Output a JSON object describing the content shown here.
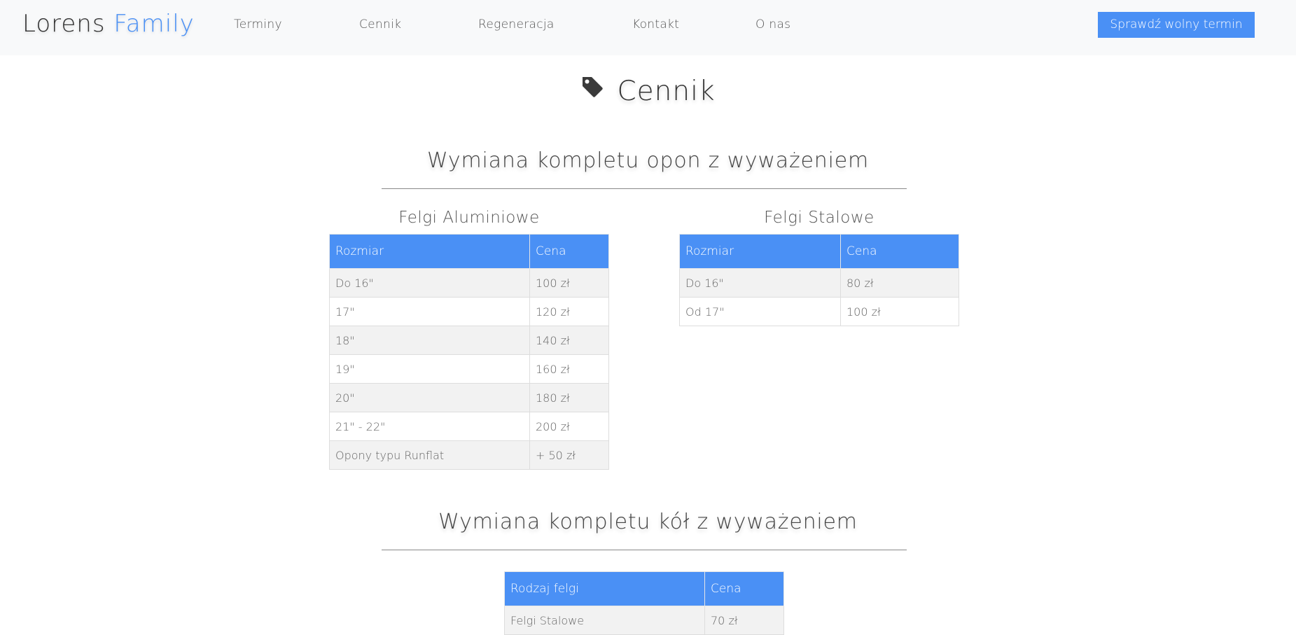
{
  "nav": {
    "brand_part1": "Lorens ",
    "brand_part2": "Family",
    "links": [
      "Terminy",
      "Cennik",
      "Regeneracja",
      "Kontakt",
      "O nas"
    ],
    "cta": "Sprawdź wolny termin"
  },
  "page": {
    "title": "Cennik",
    "icon": "tag-icon"
  },
  "section1": {
    "title": "Wymiana kompletu opon z wyważeniem",
    "aluminium": {
      "title": "Felgi Aluminiowe",
      "headers": [
        "Rozmiar",
        "Cena"
      ],
      "rows": [
        [
          "Do 16\"",
          "100 zł"
        ],
        [
          "17\"",
          "120 zł"
        ],
        [
          "18\"",
          "140 zł"
        ],
        [
          "19\"",
          "160 zł"
        ],
        [
          "20\"",
          "180 zł"
        ],
        [
          "21\" - 22\"",
          "200 zł"
        ],
        [
          "Opony typu Runflat",
          "+ 50 zł"
        ]
      ]
    },
    "steel": {
      "title": "Felgi Stalowe",
      "headers": [
        "Rozmiar",
        "Cena"
      ],
      "rows": [
        [
          "Do 16\"",
          "80 zł"
        ],
        [
          "Od 17\"",
          "100 zł"
        ]
      ]
    }
  },
  "section2": {
    "title": "Wymiana kompletu kół z wyważeniem",
    "headers": [
      "Rodzaj felgi",
      "Cena"
    ],
    "rows": [
      [
        "Felgi Stalowe",
        "70 zł"
      ]
    ]
  },
  "colors": {
    "accent": "#4a90f5",
    "navbar_bg": "#f8f9fa",
    "row_alt": "#f2f2f2"
  }
}
